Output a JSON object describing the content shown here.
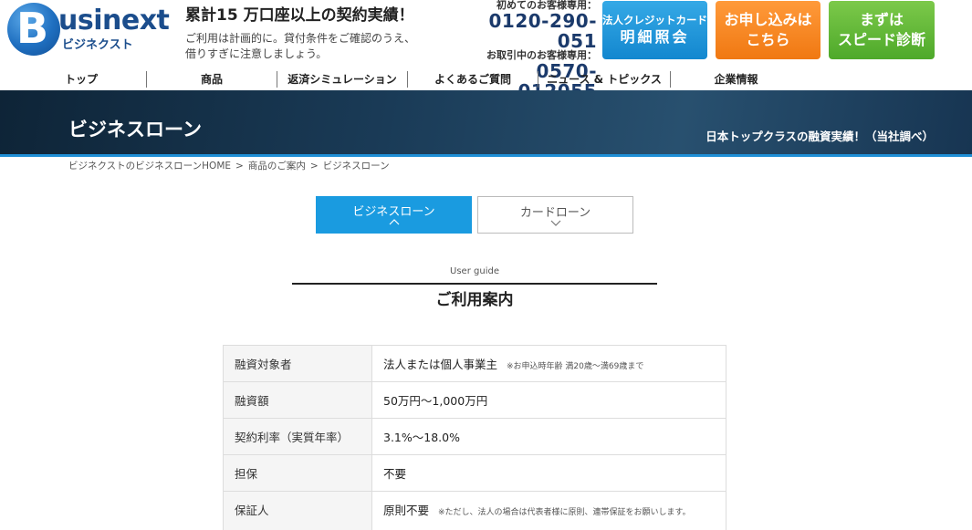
{
  "header": {
    "logo_text": "usinext",
    "logo_letter": "B",
    "logo_kana": "ビジネクスト",
    "tagline": "累計15 万口座以上の契約実績！",
    "notice_line1": "ご利用は計画的に。貸付条件をご確認のうえ、",
    "notice_line2": "借りすぎに注意しましょう。",
    "phone_label_new": "初めてのお客様専用：",
    "phone_new": "0120-290-051",
    "phone_label_existing": "お取引中のお客様専用：",
    "phone_existing": "0570-012055",
    "card_button_line1": "法人クレジットカード",
    "card_button_line2": "明細照会",
    "apply_button_line1": "お申し込みは",
    "apply_button_line2": "こちら",
    "diag_button_line1": "まずは",
    "diag_button_line2": "スピード診断"
  },
  "nav": {
    "items": [
      "トップ",
      "商品",
      "返済シミュレーション",
      "よくあるご質問",
      "ニュース & トピックス",
      "企業情報"
    ]
  },
  "banner": {
    "title": "ビジネスローン",
    "subtitle": "日本トップクラスの融資実績！（当社調べ）"
  },
  "breadcrumb": {
    "items": [
      "ビジネクストのビジネスローンHOME",
      "商品のご案内",
      "ビジネスローン"
    ],
    "separator": ">"
  },
  "tabs": [
    {
      "label": "ビジネスローン",
      "active": true
    },
    {
      "label": "カードローン",
      "active": false
    }
  ],
  "section": {
    "en": "User guide",
    "jp": "ご利用案内"
  },
  "table": {
    "rows": [
      {
        "label": "融資対象者",
        "value": "法人または個人事業主",
        "note": "※お申込時年齢 満20歳～満69歳まで"
      },
      {
        "label": "融資額",
        "value": "50万円～1,000万円",
        "note": ""
      },
      {
        "label": "契約利率（実質年率）",
        "value": "3.1%～18.0%",
        "note": ""
      },
      {
        "label": "担保",
        "value": "不要",
        "note": ""
      },
      {
        "label": "保証人",
        "value": "原則不要",
        "note": "※ただし、法人の場合は代表者様に原則、連帯保証をお願いします。"
      }
    ]
  },
  "colors": {
    "brand_blue": "#1b4d8c",
    "tab_active": "#1a9be0",
    "apply_orange": "#f07812",
    "diag_green": "#4ea92a",
    "card_blue": "#1387cf"
  }
}
